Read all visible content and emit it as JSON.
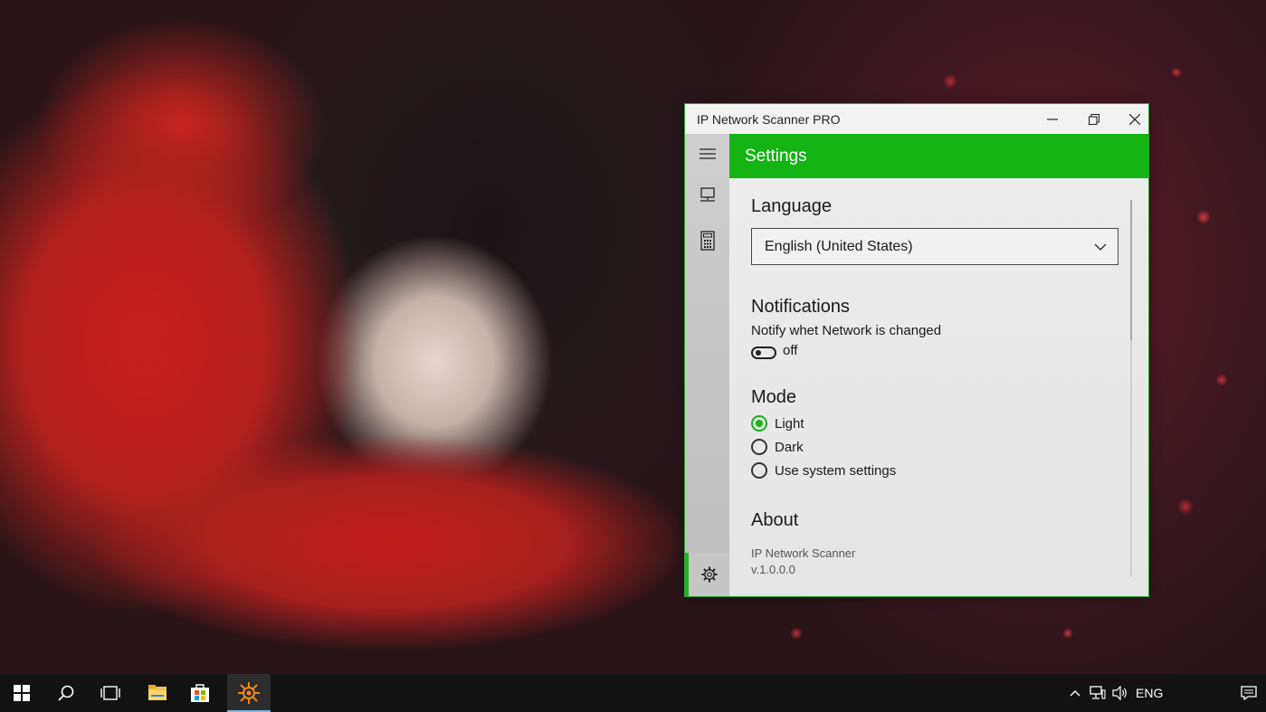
{
  "window": {
    "title": "IP Network Scanner PRO",
    "accent_color": "#13b413"
  },
  "nav": {
    "items": [
      {
        "icon": "hamburger-menu-icon"
      },
      {
        "icon": "computer-icon"
      },
      {
        "icon": "calculator-icon"
      },
      {
        "icon": "gear-icon",
        "selected": true
      }
    ]
  },
  "header": {
    "title": "Settings"
  },
  "settings": {
    "language": {
      "title": "Language",
      "selected": "English (United States)"
    },
    "notifications": {
      "title": "Notifications",
      "label": "Notify whet Network is changed",
      "toggle_state": "off"
    },
    "mode": {
      "title": "Mode",
      "options": [
        {
          "label": "Light",
          "selected": true
        },
        {
          "label": "Dark",
          "selected": false
        },
        {
          "label": "Use system settings",
          "selected": false
        }
      ]
    },
    "about": {
      "title": "About",
      "app_name": "IP Network Scanner",
      "version": "v.1.0.0.0"
    }
  },
  "taskbar": {
    "items": [
      "start-icon",
      "search-icon",
      "task-view-icon",
      "file-explorer-icon",
      "store-icon",
      "ip-scanner-icon"
    ],
    "language": "ENG"
  }
}
